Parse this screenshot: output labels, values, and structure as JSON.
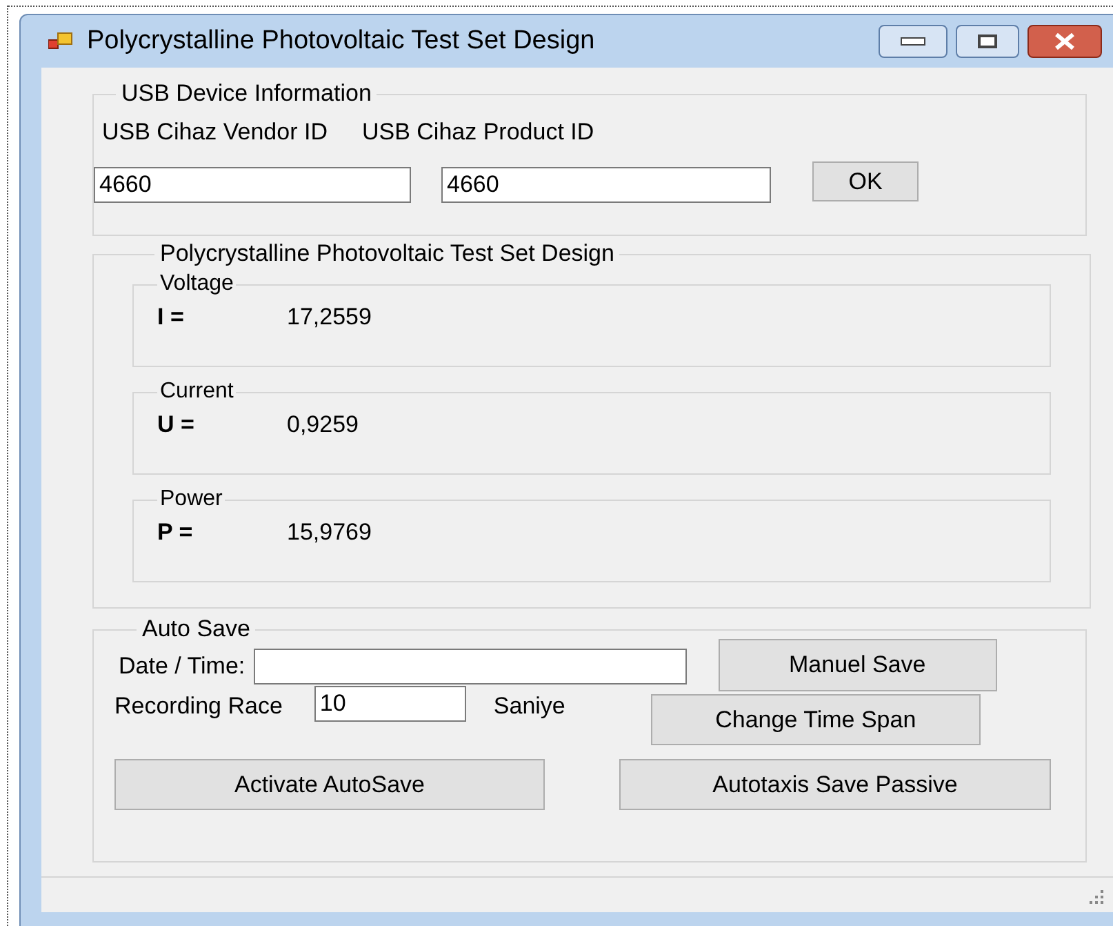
{
  "window": {
    "title": "Polycrystalline Photovoltaic Test Set Design"
  },
  "usb_group": {
    "title": "USB Device Information",
    "vendor_label": "USB Cihaz Vendor ID",
    "product_label": "USB Cihaz Product ID",
    "vendor_value": "4660",
    "product_value": "4660",
    "ok_button": "OK"
  },
  "measurements": {
    "title": "Polycrystalline Photovoltaic Test Set Design",
    "readings": [
      {
        "title": "Voltage",
        "symbol": "I =",
        "value": "17,2559"
      },
      {
        "title": "Current",
        "symbol": "U =",
        "value": "0,9259"
      },
      {
        "title": "Power",
        "symbol": "P =",
        "value": "15,9769"
      }
    ]
  },
  "auto_save": {
    "title": "Auto Save",
    "date_label": "Date / Time:",
    "manual_save_button": "Manuel Save",
    "recording_label": "Recording Race",
    "recording_value": "10",
    "unit": "Saniye",
    "change_span_button": "Change Time Span",
    "activate_button": "Activate AutoSave",
    "passive_button": "Autotaxis Save Passive"
  }
}
